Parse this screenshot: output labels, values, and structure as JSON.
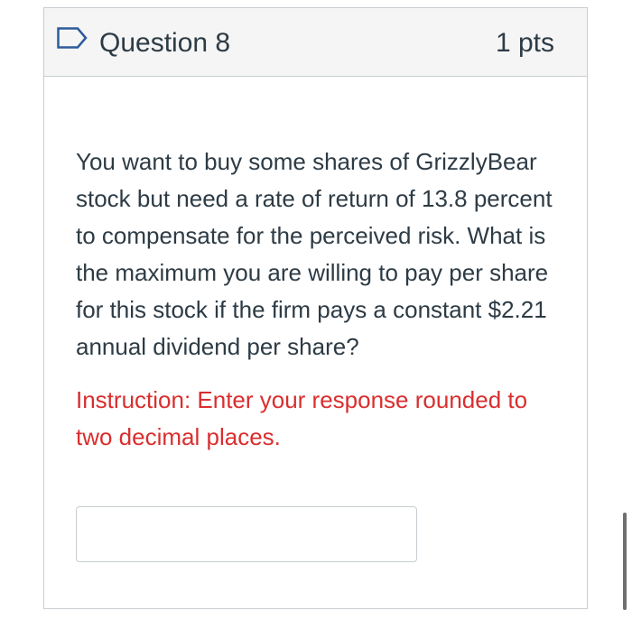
{
  "question": {
    "title": "Question 8",
    "points": "1 pts",
    "flag_icon": "flag-outline-icon",
    "accent_color": "#2d5b9c"
  },
  "body": {
    "text": "You want to buy some shares of GrizzlyBear stock but need a rate of return of 13.8 percent to compensate for the perceived risk. What is the maximum you are willing to pay per share for this stock if the firm pays a constant $2.21 annual dividend per share?",
    "instruction": "Instruction: Enter your response rounded to two decimal places.",
    "instruction_color": "#d92e2e"
  },
  "answer": {
    "value": "",
    "placeholder": ""
  }
}
